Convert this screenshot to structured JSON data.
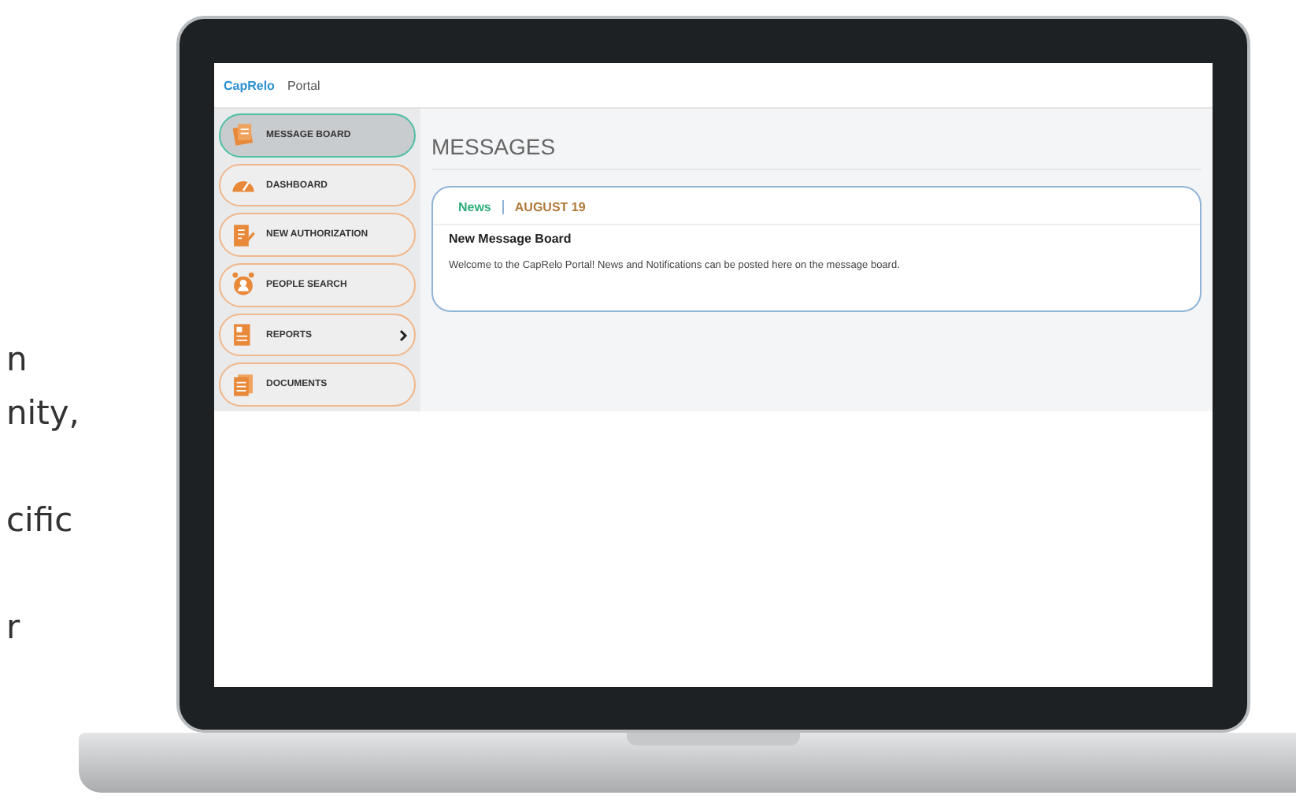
{
  "side_text": [
    [
      "n",
      "nity,"
    ],
    [
      "cific"
    ],
    [
      "r"
    ]
  ],
  "portal": {
    "logo": "CapRelo",
    "title": "Portal",
    "menu": [
      {
        "label": "MESSAGE BOARD",
        "kind": "notes",
        "selected": true,
        "has_submenu": false
      },
      {
        "label": "DASHBOARD",
        "kind": "gauge",
        "selected": false,
        "has_submenu": false
      },
      {
        "label": "NEW AUTHORIZATION",
        "kind": "form",
        "selected": false,
        "has_submenu": false
      },
      {
        "label": "PEOPLE SEARCH",
        "kind": "person",
        "selected": false,
        "has_submenu": false
      },
      {
        "label": "REPORTS",
        "kind": "report",
        "selected": false,
        "has_submenu": true
      },
      {
        "label": "DOCUMENTS",
        "kind": "files",
        "selected": false,
        "has_submenu": false
      }
    ],
    "heading": "MESSAGES",
    "message": {
      "tag": "News",
      "date": "AUGUST 19",
      "title": "New Message Board",
      "body": "Welcome to the CapRelo Portal! News and Notifications can be posted here on the message board."
    }
  }
}
